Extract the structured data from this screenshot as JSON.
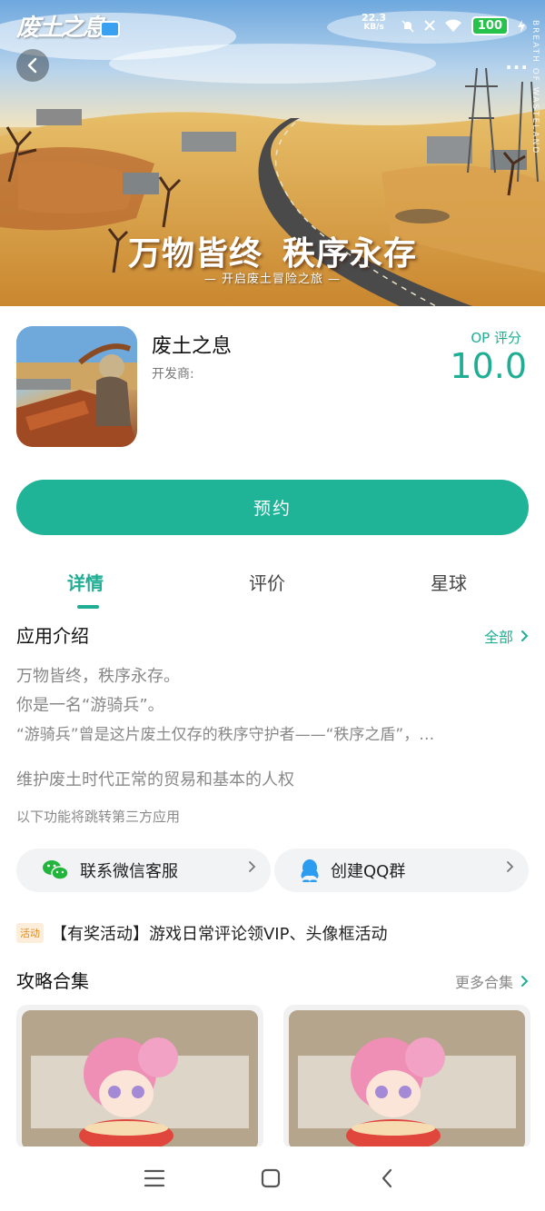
{
  "status_bar": {
    "logo_text": "废土之息",
    "net_speed_value": "22.3",
    "net_speed_unit": "KB/s",
    "battery": "100"
  },
  "hero": {
    "vertical_text": "BREATH OF WASTELAND",
    "slogan_part1": "万物皆终",
    "slogan_part2": "秩序永存",
    "subslogan": "— 开启废土冒险之旅 —"
  },
  "app": {
    "name": "废土之息",
    "developer_label": "开发商:",
    "score_label": "OP 评分",
    "score_value": "10.0"
  },
  "reserve_button": "预约",
  "tabs": [
    {
      "label": "详情",
      "active": true
    },
    {
      "label": "评价",
      "active": false
    },
    {
      "label": "星球",
      "active": false
    }
  ],
  "intro": {
    "title": "应用介绍",
    "more": "全部",
    "lines": [
      "万物皆终，秩序永存。",
      "你是一名“游骑兵”。",
      "“游骑兵”曾是这片废土仅存的秩序守护者——“秩序之盾”，…",
      "维护废土时代正常的贸易和基本的人权"
    ],
    "third_party_hint": "以下功能将跳转第三方应用"
  },
  "third_party": [
    {
      "label": "联系微信客服",
      "icon": "wechat-icon"
    },
    {
      "label": "创建QQ群",
      "icon": "qq-icon"
    }
  ],
  "promo": {
    "tag": "活动",
    "text": "【有奖活动】游戏日常评论领VIP、头像框活动"
  },
  "guides": {
    "title": "攻略合集",
    "more": "更多合集"
  },
  "colors": {
    "accent": "#1fae94",
    "button": "#1fb498",
    "promo_tag": "#e08a1e"
  }
}
